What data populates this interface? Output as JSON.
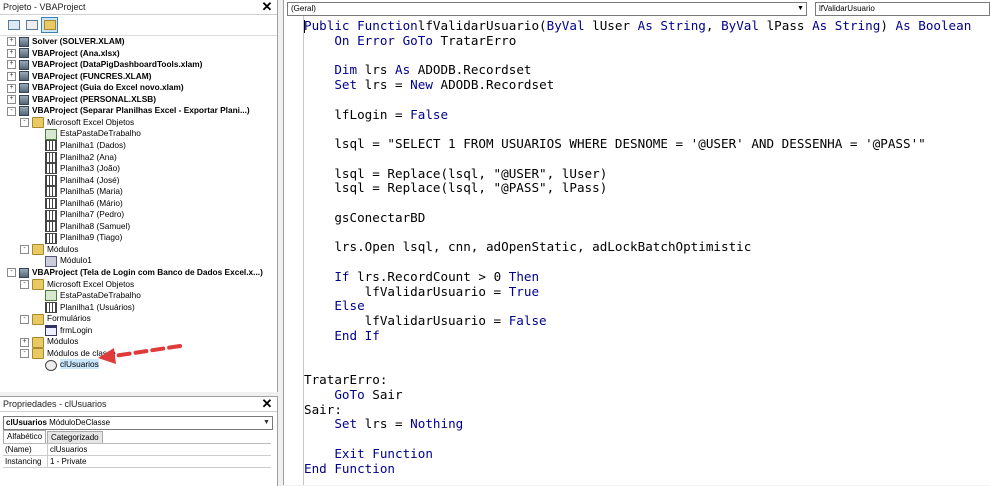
{
  "project": {
    "title": "Projeto - VBAProject",
    "items": [
      {
        "label": "Solver (SOLVER.XLAM)",
        "level": 0,
        "exp": "+",
        "icon": "proj",
        "bold": true
      },
      {
        "label": "VBAProject (Ana.xlsx)",
        "level": 0,
        "exp": "+",
        "icon": "proj",
        "bold": true
      },
      {
        "label": "VBAProject (DataPigDashboardTools.xlam)",
        "level": 0,
        "exp": "+",
        "icon": "proj",
        "bold": true
      },
      {
        "label": "VBAProject (FUNCRES.XLAM)",
        "level": 0,
        "exp": "+",
        "icon": "proj",
        "bold": true
      },
      {
        "label": "VBAProject (Guia do Excel novo.xlam)",
        "level": 0,
        "exp": "+",
        "icon": "proj",
        "bold": true
      },
      {
        "label": "VBAProject (PERSONAL.XLSB)",
        "level": 0,
        "exp": "+",
        "icon": "proj",
        "bold": true
      },
      {
        "label": "VBAProject (Separar Planilhas Excel - Exportar Plani...)",
        "level": 0,
        "exp": "-",
        "icon": "proj",
        "bold": true
      },
      {
        "label": "Microsoft Excel Objetos",
        "level": 1,
        "exp": "-",
        "icon": "folder",
        "bold": false
      },
      {
        "label": "EstaPastaDeTrabalho",
        "level": 2,
        "exp": "",
        "icon": "book",
        "bold": false
      },
      {
        "label": "Planilha1 (Dados)",
        "level": 2,
        "exp": "",
        "icon": "sheet",
        "bold": false
      },
      {
        "label": "Planilha2 (Ana)",
        "level": 2,
        "exp": "",
        "icon": "sheet",
        "bold": false
      },
      {
        "label": "Planilha3 (João)",
        "level": 2,
        "exp": "",
        "icon": "sheet",
        "bold": false
      },
      {
        "label": "Planilha4 (José)",
        "level": 2,
        "exp": "",
        "icon": "sheet",
        "bold": false
      },
      {
        "label": "Planilha5 (Maria)",
        "level": 2,
        "exp": "",
        "icon": "sheet",
        "bold": false
      },
      {
        "label": "Planilha6 (Mário)",
        "level": 2,
        "exp": "",
        "icon": "sheet",
        "bold": false
      },
      {
        "label": "Planilha7 (Pedro)",
        "level": 2,
        "exp": "",
        "icon": "sheet",
        "bold": false
      },
      {
        "label": "Planilha8 (Samuel)",
        "level": 2,
        "exp": "",
        "icon": "sheet",
        "bold": false
      },
      {
        "label": "Planilha9 (Tiago)",
        "level": 2,
        "exp": "",
        "icon": "sheet",
        "bold": false
      },
      {
        "label": "Módulos",
        "level": 1,
        "exp": "-",
        "icon": "folder",
        "bold": false
      },
      {
        "label": "Módulo1",
        "level": 2,
        "exp": "",
        "icon": "module",
        "bold": false
      },
      {
        "label": "VBAProject (Tela de Login com Banco de Dados Excel.x...)",
        "level": 0,
        "exp": "-",
        "icon": "proj",
        "bold": true
      },
      {
        "label": "Microsoft Excel Objetos",
        "level": 1,
        "exp": "-",
        "icon": "folder",
        "bold": false
      },
      {
        "label": "EstaPastaDeTrabalho",
        "level": 2,
        "exp": "",
        "icon": "book",
        "bold": false
      },
      {
        "label": "Planilha1 (Usuários)",
        "level": 2,
        "exp": "",
        "icon": "sheet",
        "bold": false
      },
      {
        "label": "Formulários",
        "level": 1,
        "exp": "-",
        "icon": "folder",
        "bold": false
      },
      {
        "label": "frmLogin",
        "level": 2,
        "exp": "",
        "icon": "form",
        "bold": false
      },
      {
        "label": "Módulos",
        "level": 1,
        "exp": "+",
        "icon": "folder",
        "bold": false
      },
      {
        "label": "Módulos de classe",
        "level": 1,
        "exp": "-",
        "icon": "folder",
        "bold": false
      },
      {
        "label": "clUsuarios",
        "level": 2,
        "exp": "",
        "icon": "class",
        "bold": false,
        "selected": true
      }
    ]
  },
  "properties": {
    "title": "Propriedades - clUsuarios",
    "object_bold": "clUsuarios",
    "object_type": "MóduloDeClasse",
    "tabs": [
      "Alfabético",
      "Categorizado"
    ],
    "rows": [
      {
        "key": "(Name)",
        "value": "clUsuarios"
      },
      {
        "key": "Instancing",
        "value": "1 - Private"
      }
    ]
  },
  "code_window": {
    "object_combo": "(Geral)",
    "proc_combo": "lfValidarUsuario",
    "lines": [
      [
        [
          "kw",
          "Public Function"
        ],
        [
          "",
          "lfValidarUsuario("
        ],
        [
          "kw",
          "ByVal"
        ],
        [
          "",
          " lUser "
        ],
        [
          "kw",
          "As String"
        ],
        [
          "",
          ", "
        ],
        [
          "kw",
          "ByVal"
        ],
        [
          "",
          " lPass "
        ],
        [
          "kw",
          "As String"
        ],
        [
          "",
          ") "
        ],
        [
          "kw",
          "As Boolean"
        ]
      ],
      [
        [
          "",
          "    "
        ],
        [
          "kw",
          "On Error GoTo"
        ],
        [
          "",
          " TratarErro"
        ]
      ],
      [
        [
          "",
          ""
        ]
      ],
      [
        [
          "",
          "    "
        ],
        [
          "kw",
          "Dim"
        ],
        [
          "",
          " lrs "
        ],
        [
          "kw",
          "As"
        ],
        [
          "",
          " ADODB.Recordset"
        ]
      ],
      [
        [
          "",
          "    "
        ],
        [
          "kw",
          "Set"
        ],
        [
          "",
          " lrs = "
        ],
        [
          "kw",
          "New"
        ],
        [
          "",
          " ADODB.Recordset"
        ]
      ],
      [
        [
          "",
          ""
        ]
      ],
      [
        [
          "",
          "    lfLogin = "
        ],
        [
          "kw",
          "False"
        ]
      ],
      [
        [
          "",
          ""
        ]
      ],
      [
        [
          "",
          "    lsql = \"SELECT 1 FROM USUARIOS WHERE DESNOME = '@USER' AND DESSENHA = '@PASS'\""
        ]
      ],
      [
        [
          "",
          ""
        ]
      ],
      [
        [
          "",
          "    lsql = Replace(lsql, \"@USER\", lUser)"
        ]
      ],
      [
        [
          "",
          "    lsql = Replace(lsql, \"@PASS\", lPass)"
        ]
      ],
      [
        [
          "",
          ""
        ]
      ],
      [
        [
          "",
          "    gsConectarBD"
        ]
      ],
      [
        [
          "",
          ""
        ]
      ],
      [
        [
          "",
          "    lrs.Open lsql, cnn, adOpenStatic, adLockBatchOptimistic"
        ]
      ],
      [
        [
          "",
          ""
        ]
      ],
      [
        [
          "",
          "    "
        ],
        [
          "kw",
          "If"
        ],
        [
          "",
          " lrs.RecordCount > 0 "
        ],
        [
          "kw",
          "Then"
        ]
      ],
      [
        [
          "",
          "        lfValidarUsuario = "
        ],
        [
          "kw",
          "True"
        ]
      ],
      [
        [
          "",
          "    "
        ],
        [
          "kw",
          "Else"
        ]
      ],
      [
        [
          "",
          "        lfValidarUsuario = "
        ],
        [
          "kw",
          "False"
        ]
      ],
      [
        [
          "",
          "    "
        ],
        [
          "kw",
          "End If"
        ]
      ],
      [
        [
          "",
          ""
        ]
      ],
      [
        [
          "",
          ""
        ]
      ],
      [
        [
          "",
          "TratarErro:"
        ]
      ],
      [
        [
          "",
          "    "
        ],
        [
          "kw",
          "GoTo"
        ],
        [
          "",
          " Sair"
        ]
      ],
      [
        [
          "",
          "Sair:"
        ]
      ],
      [
        [
          "",
          "    "
        ],
        [
          "kw",
          "Set"
        ],
        [
          "",
          " lrs = "
        ],
        [
          "kw",
          "Nothing"
        ]
      ],
      [
        [
          "",
          ""
        ]
      ],
      [
        [
          "",
          "    "
        ],
        [
          "kw",
          "Exit Function"
        ]
      ],
      [
        [
          "kw",
          "End Function"
        ]
      ]
    ]
  },
  "colors": {
    "keyword": "#00008b",
    "arrow": "#e03a3a",
    "selection": "#cce8ff"
  }
}
